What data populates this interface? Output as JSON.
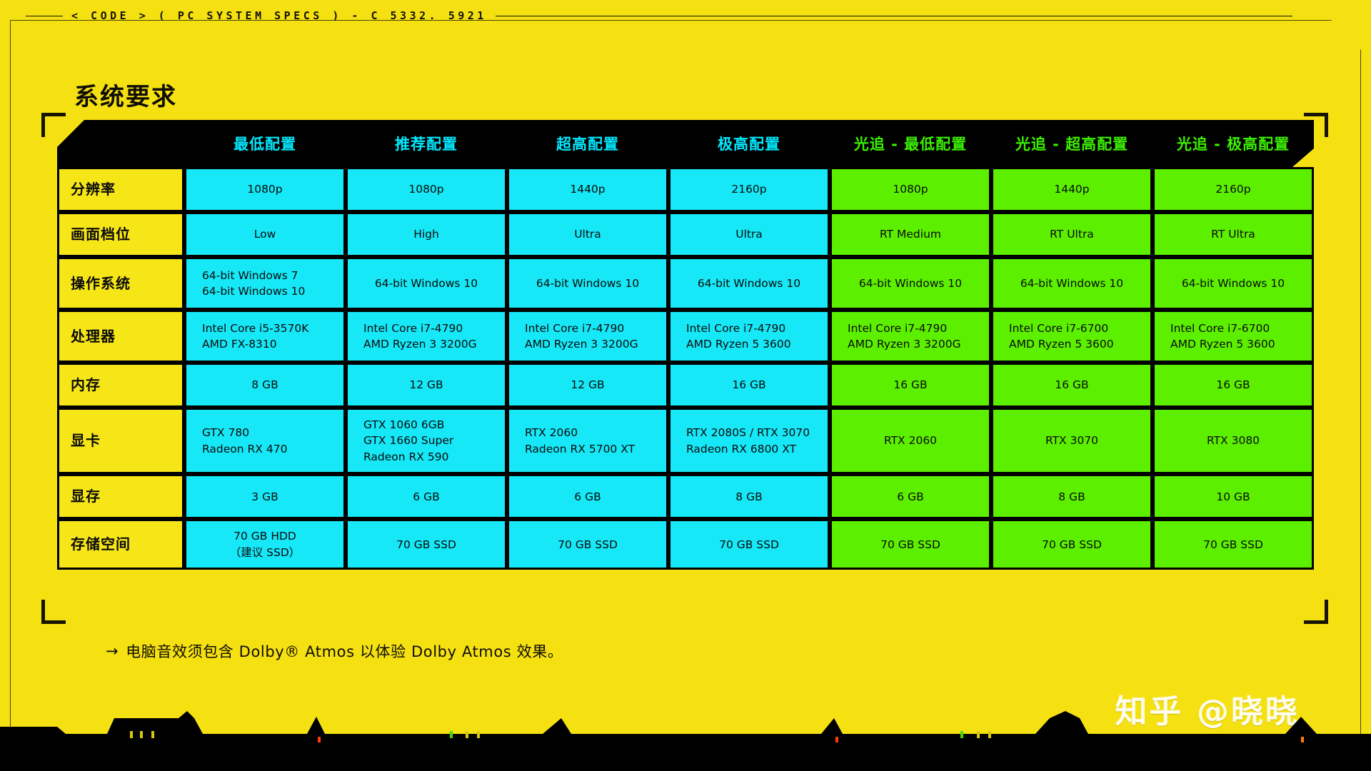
{
  "topbar": {
    "code_label": "< CODE > ( PC SYSTEM SPECS ) - C 5332. 5921"
  },
  "page": {
    "title": "系统要求"
  },
  "table": {
    "corner_header": "",
    "columns": [
      {
        "label": "最低配置",
        "type": "standard"
      },
      {
        "label": "推荐配置",
        "type": "standard"
      },
      {
        "label": "超高配置",
        "type": "standard"
      },
      {
        "label": "极高配置",
        "type": "standard"
      },
      {
        "label": "光追 - 最低配置",
        "type": "raytracing"
      },
      {
        "label": "光追 - 超高配置",
        "type": "raytracing"
      },
      {
        "label": "光追 - 极高配置",
        "type": "raytracing"
      }
    ],
    "rows": [
      {
        "label": "分辨率",
        "cells": [
          "1080p",
          "1080p",
          "1440p",
          "2160p",
          "1080p",
          "1440p",
          "2160p"
        ]
      },
      {
        "label": "画面档位",
        "cells": [
          "Low",
          "High",
          "Ultra",
          "Ultra",
          "RT Medium",
          "RT Ultra",
          "RT Ultra"
        ]
      },
      {
        "label": "操作系统",
        "cells": [
          "64-bit Windows 7\n64-bit Windows 10",
          "64-bit Windows 10",
          "64-bit Windows 10",
          "64-bit Windows 10",
          "64-bit Windows 10",
          "64-bit Windows 10",
          "64-bit Windows 10"
        ]
      },
      {
        "label": "处理器",
        "cells": [
          "Intel Core i5-3570K\nAMD FX-8310",
          "Intel Core i7-4790\nAMD Ryzen 3 3200G",
          "Intel Core i7-4790\nAMD Ryzen 3 3200G",
          "Intel Core i7-4790\nAMD Ryzen 5 3600",
          "Intel Core i7-4790\nAMD Ryzen 3 3200G",
          "Intel Core i7-6700\nAMD Ryzen 5 3600",
          "Intel Core i7-6700\nAMD Ryzen 5 3600"
        ]
      },
      {
        "label": "内存",
        "cells": [
          "8 GB",
          "12 GB",
          "12 GB",
          "16 GB",
          "16 GB",
          "16 GB",
          "16 GB"
        ]
      },
      {
        "label": "显卡",
        "cells": [
          "GTX 780\nRadeon RX 470",
          "GTX 1060 6GB\nGTX 1660 Super\nRadeon RX 590",
          "RTX 2060\nRadeon RX 5700 XT",
          "RTX 2080S / RTX 3070\nRadeon RX 6800 XT",
          "RTX 2060",
          "RTX 3070",
          "RTX 3080"
        ]
      },
      {
        "label": "显存",
        "cells": [
          "3 GB",
          "6 GB",
          "6 GB",
          "8 GB",
          "6 GB",
          "8 GB",
          "10 GB"
        ]
      },
      {
        "label": "存储空间",
        "cells": [
          "70 GB HDD\n（建议 SSD）",
          "70 GB SSD",
          "70 GB SSD",
          "70 GB SSD",
          "70 GB SSD",
          "70 GB SSD",
          "70 GB SSD"
        ]
      }
    ]
  },
  "footnote": {
    "arrow": "→",
    "text": "电脑音效须包含 Dolby® Atmos 以体验 Dolby Atmos 效果。"
  },
  "watermark": {
    "text": "知乎 @晓晓"
  },
  "colors": {
    "background": "#f5e111",
    "standard_cell": "#16e8f7",
    "raytracing_cell": "#5cf000",
    "row_label_cell": "#f7e617",
    "header_bar": "#000000",
    "header_text_standard": "#00e9ff",
    "header_text_raytracing": "#3cf000"
  }
}
